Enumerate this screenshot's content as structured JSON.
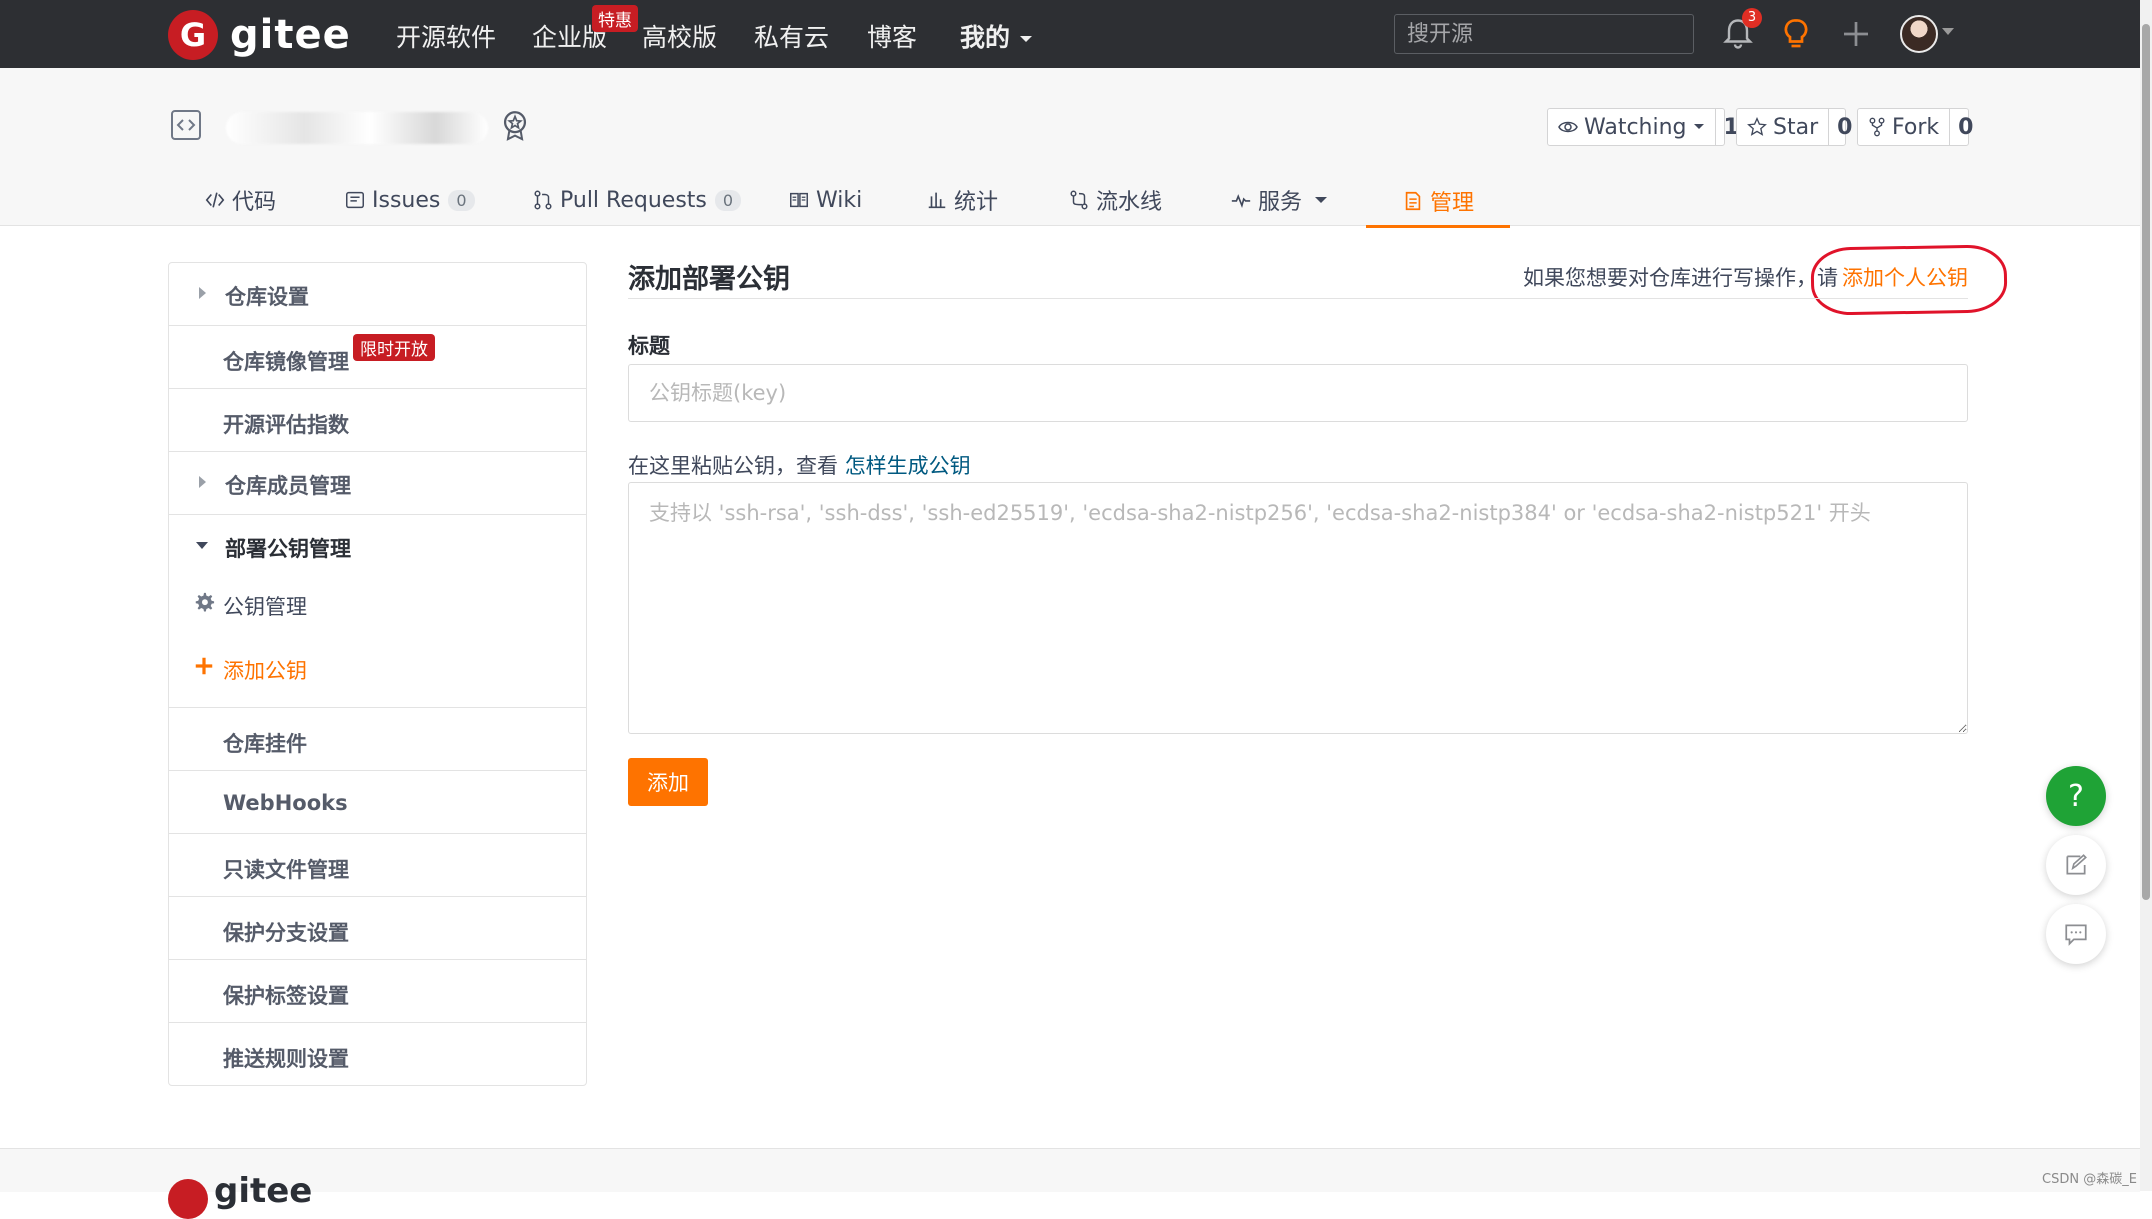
{
  "topnav": {
    "logo_text": "gitee",
    "links": [
      "开源软件",
      "企业版",
      "高校版",
      "私有云",
      "博客",
      "我的"
    ],
    "promo_badge": "特惠",
    "search_placeholder": "搜开源",
    "notification_count": "3",
    "icons": [
      "bell-icon",
      "lightbulb-icon",
      "plus-icon",
      "avatar"
    ]
  },
  "repo": {
    "watch_label": "Watching",
    "watch_count": "1",
    "star_label": "Star",
    "star_count": "0",
    "fork_label": "Fork",
    "fork_count": "0"
  },
  "tabs": [
    {
      "label": "代码"
    },
    {
      "label": "Issues",
      "count": "0"
    },
    {
      "label": "Pull Requests",
      "count": "0"
    },
    {
      "label": "Wiki"
    },
    {
      "label": "统计"
    },
    {
      "label": "流水线"
    },
    {
      "label": "服务"
    },
    {
      "label": "管理",
      "active": true
    }
  ],
  "sidebar": {
    "items": [
      {
        "label": "仓库设置"
      },
      {
        "label": "仓库镜像管理",
        "badge": "限时开放"
      },
      {
        "label": "开源评估指数"
      },
      {
        "label": "仓库成员管理"
      },
      {
        "label": "部署公钥管理"
      },
      {
        "label": "仓库挂件"
      },
      {
        "label": "WebHooks"
      },
      {
        "label": "只读文件管理"
      },
      {
        "label": "保护分支设置"
      },
      {
        "label": "保护标签设置"
      },
      {
        "label": "推送规则设置"
      }
    ],
    "subitems": [
      {
        "label": "公钥管理"
      },
      {
        "label": "添加公钥"
      }
    ]
  },
  "main": {
    "title": "添加部署公钥",
    "hint_text": "如果您想要对仓库进行写操作，请",
    "hint_link": "添加个人公钥",
    "title_field_label": "标题",
    "title_placeholder": "公钥标题(key)",
    "paste_label": "在这里粘贴公钥，查看",
    "paste_link": "怎样生成公钥",
    "key_placeholder": "支持以 'ssh-rsa', 'ssh-dss', 'ssh-ed25519', 'ecdsa-sha2-nistp256', 'ecdsa-sha2-nistp384' or 'ecdsa-sha2-nistp521' 开头",
    "submit_label": "添加"
  },
  "floating": {
    "help_label": "?"
  },
  "footer": {
    "logo_text": "gitee",
    "watermark": "CSDN @森碳_E"
  },
  "colors": {
    "accent": "#fe7300",
    "brand": "#c71d23",
    "nav_bg": "#2d2f33",
    "link": "#005980",
    "help_green": "#1fa336",
    "annotation_red": "#e0132a"
  }
}
